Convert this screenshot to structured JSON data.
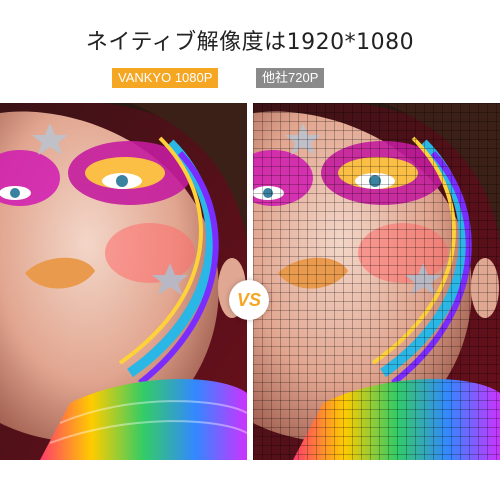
{
  "title": "ネイティブ解像度は1920*1080",
  "badges": {
    "left": "VANKYO 1080P",
    "right": "他社720P"
  },
  "vs_label": "VS",
  "colors": {
    "accent_orange": "#f5a623",
    "badge_gray": "#8a8a8a",
    "title_text": "#222222"
  },
  "icons": {
    "vs": "vs-circle-icon"
  }
}
